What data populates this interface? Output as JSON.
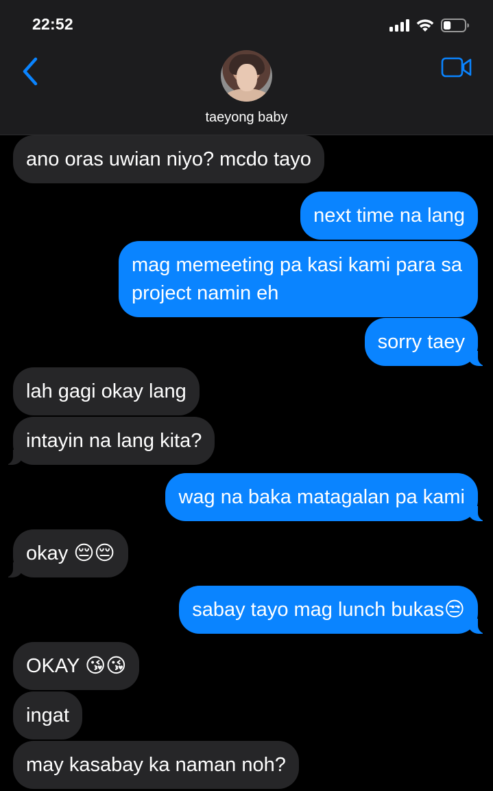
{
  "status_bar": {
    "time": "22:52",
    "signal_bars": 4,
    "battery_level_percent": 35
  },
  "header": {
    "contact_name": "taeyong baby",
    "back_icon": "chevron-left-icon",
    "video_icon": "video-camera-icon",
    "accent_color": "#0a84ff"
  },
  "messages": [
    {
      "direction": "incoming",
      "text": "ano oras uwian niyo? mcdo tayo"
    },
    {
      "direction": "outgoing",
      "text": "next time na lang"
    },
    {
      "direction": "outgoing",
      "text": "mag memeeting pa kasi kami para sa project namin eh"
    },
    {
      "direction": "outgoing",
      "text": "sorry taey"
    },
    {
      "direction": "incoming",
      "text": "lah gagi okay lang"
    },
    {
      "direction": "incoming",
      "text": "intayin na lang kita?"
    },
    {
      "direction": "outgoing",
      "text": "wag na baka matagalan pa kami"
    },
    {
      "direction": "incoming",
      "text": "okay 😔😔"
    },
    {
      "direction": "outgoing",
      "text": "sabay tayo mag lunch bukas😒"
    },
    {
      "direction": "incoming",
      "text": "OKAY 😘😘"
    },
    {
      "direction": "incoming",
      "text": "ingat"
    },
    {
      "direction": "incoming",
      "text": "may kasabay ka naman noh?"
    }
  ]
}
